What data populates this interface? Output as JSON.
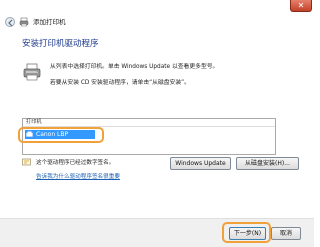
{
  "window": {
    "close_label": "✕",
    "title": "添加打印机"
  },
  "heading": "安装打印机驱动程序",
  "description": {
    "line1": "从列表中选择打印机。单击 Windows Update 以查看更多型号。",
    "line2": "若要从安装 CD 安装驱动程序，请单击“从磁盘安装”。"
  },
  "printer_list": {
    "header": "打印机",
    "items": [
      {
        "label": "Canon LBP",
        "selected": true
      }
    ]
  },
  "signature": {
    "status": "这个驱动程序已经过数字签名。",
    "link": "告诉我为什么驱动程序签名很重要"
  },
  "buttons": {
    "windows_update": "Windows Update",
    "from_disk": "从磁盘安装(H)...",
    "next": "下一步(N)",
    "cancel": "取消"
  },
  "colors": {
    "accent_highlight": "#f1a13a",
    "selection": "#3399ff",
    "heading": "#1e3a8c",
    "link": "#1a5fb4"
  }
}
